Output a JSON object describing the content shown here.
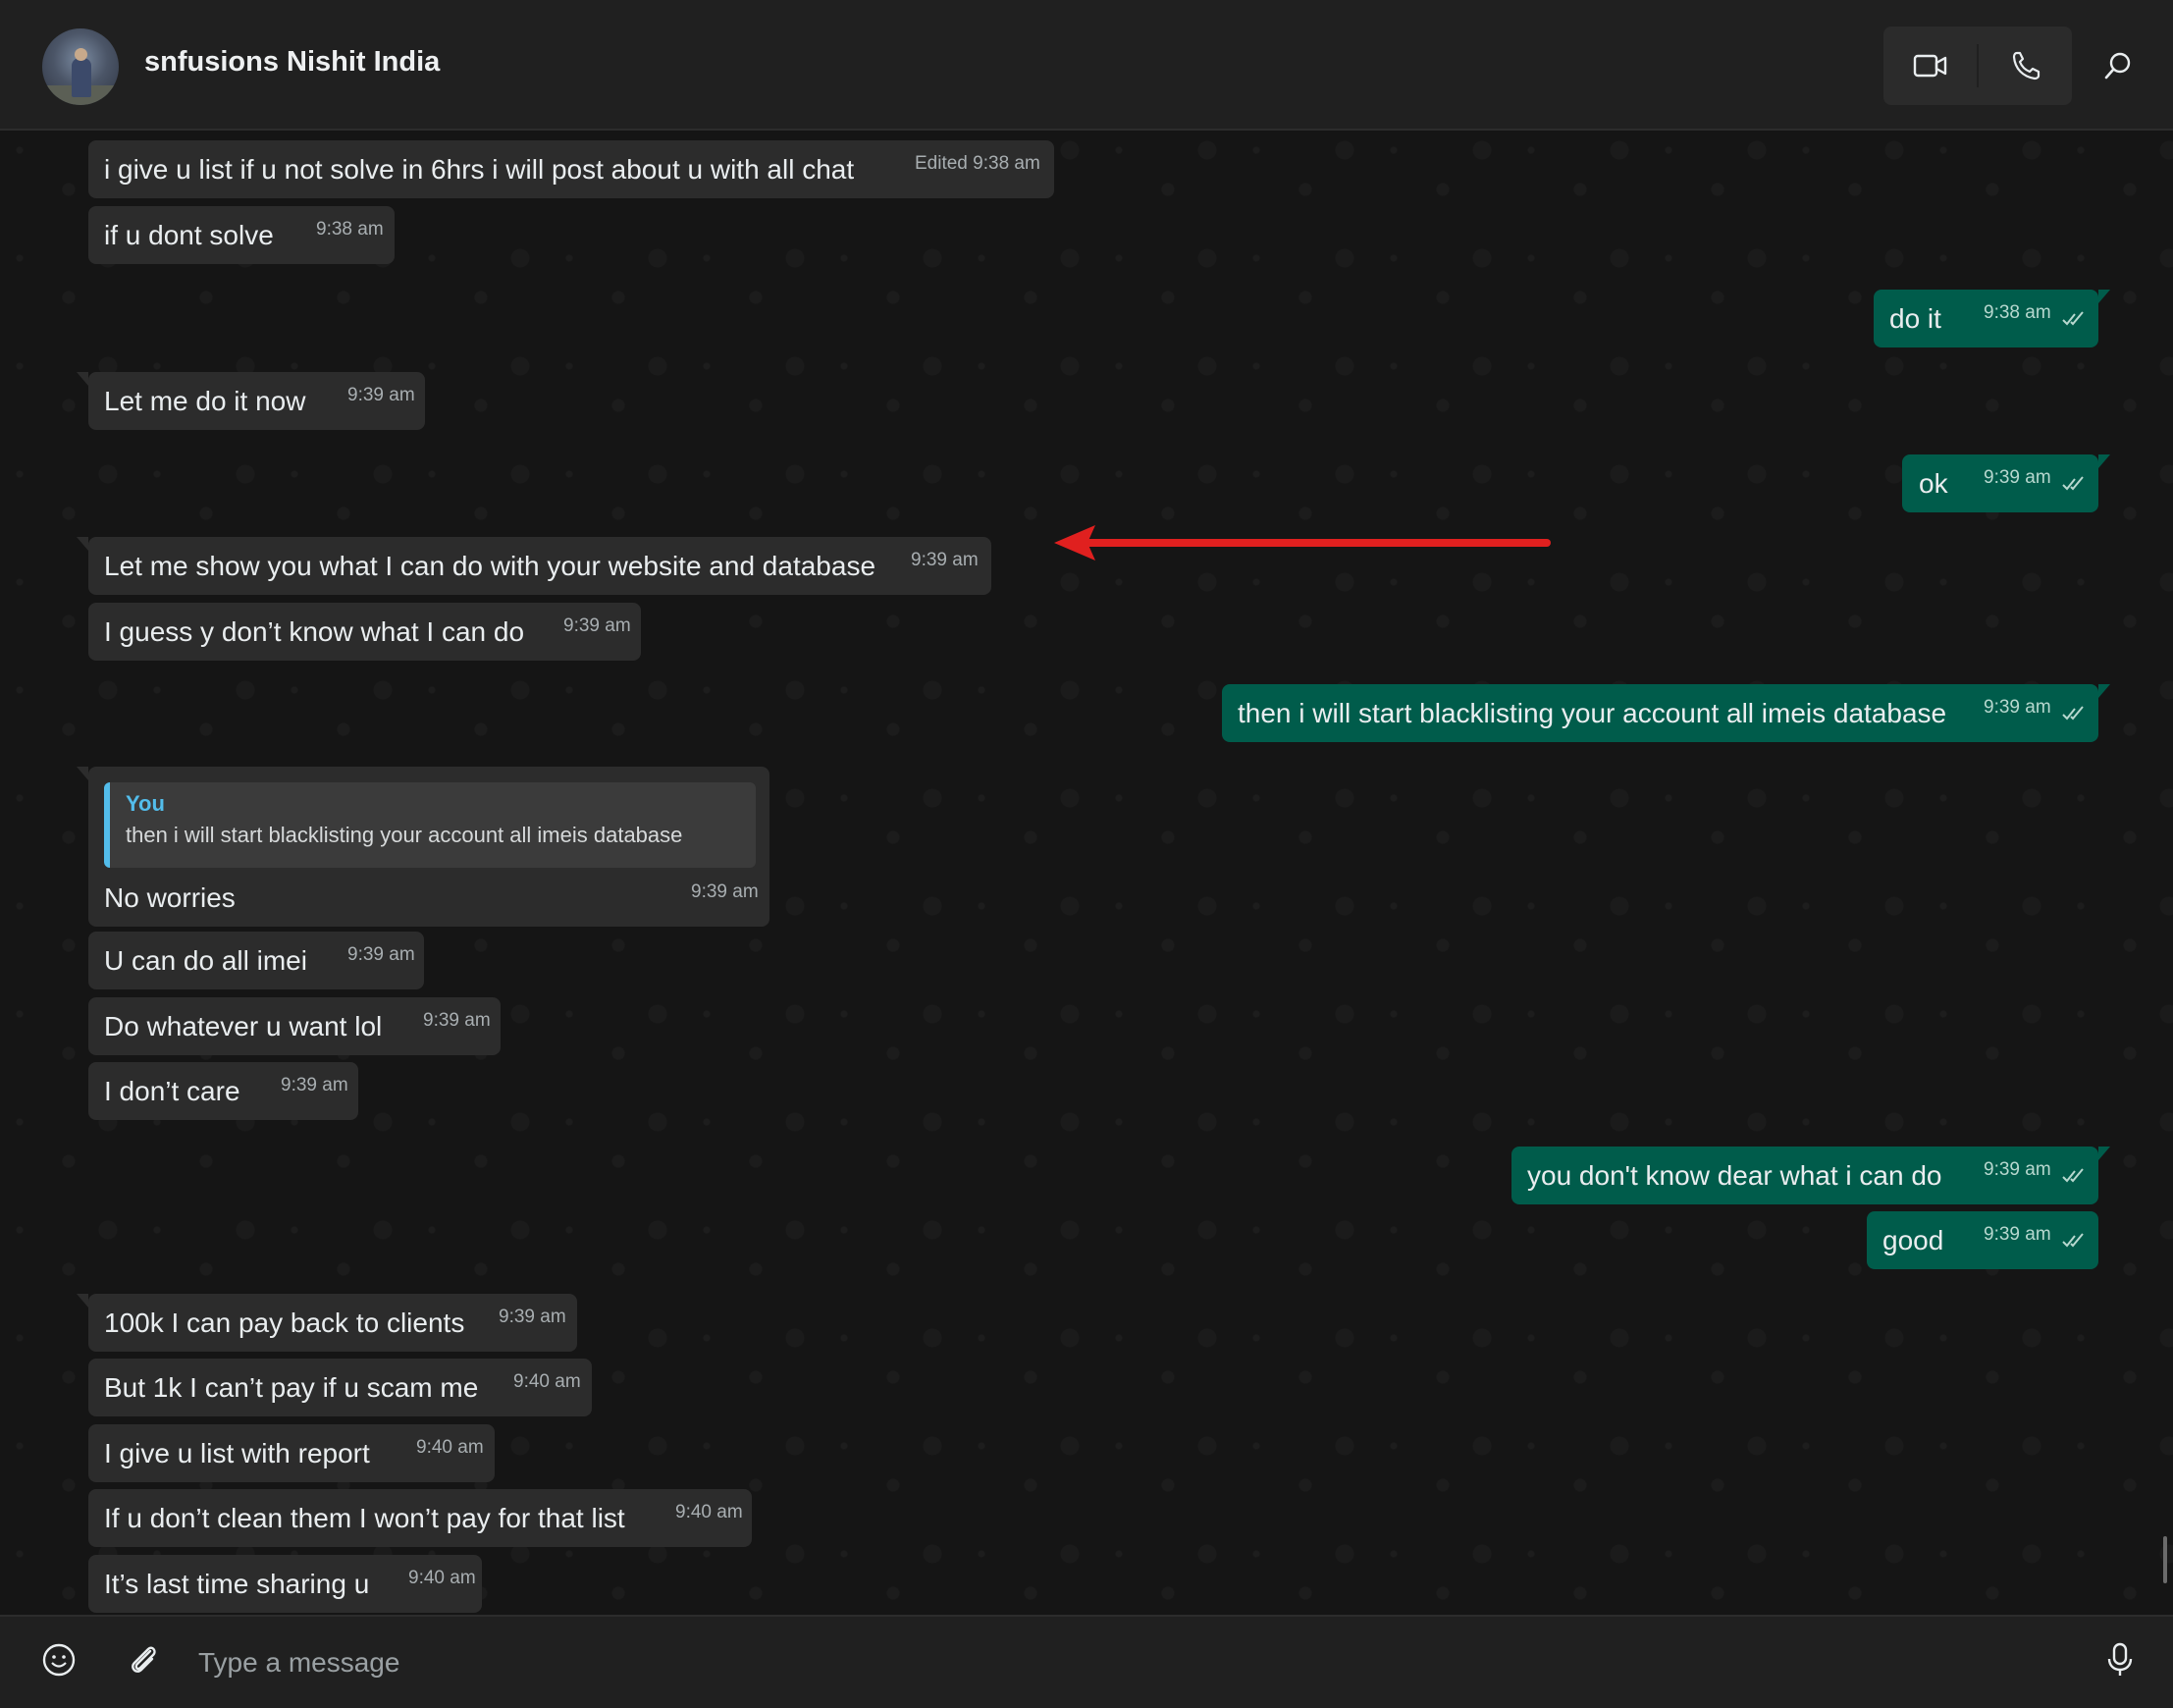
{
  "header": {
    "contact_name": "snfusions Nishit India"
  },
  "messages": [
    {
      "dir": "in",
      "text": "i give u list if u not solve in 6hrs i will post about u with all chat",
      "time": "Edited 9:38 am"
    },
    {
      "dir": "in",
      "text": "if u dont solve",
      "time": "9:38 am"
    },
    {
      "dir": "out",
      "text": "do it",
      "time": "9:38 am"
    },
    {
      "dir": "in",
      "text": "Let me do it now",
      "time": "9:39 am"
    },
    {
      "dir": "out",
      "text": "ok",
      "time": "9:39 am"
    },
    {
      "dir": "in",
      "text": "Let me show you what I can do with your website and database",
      "time": "9:39 am"
    },
    {
      "dir": "in",
      "text": "I guess y don’t know what I can do",
      "time": "9:39 am"
    },
    {
      "dir": "out",
      "text": "then i will start blacklisting your account all imeis database",
      "time": "9:39 am"
    },
    {
      "dir": "in",
      "text": "No worries",
      "time": "9:39 am",
      "quote_author": "You",
      "quote_text": "then i will start blacklisting your account all imeis database"
    },
    {
      "dir": "in",
      "text": "U can do all imei",
      "time": "9:39 am"
    },
    {
      "dir": "in",
      "text": "Do whatever u want lol",
      "time": "9:39 am"
    },
    {
      "dir": "in",
      "text": "I don’t care",
      "time": "9:39 am"
    },
    {
      "dir": "out",
      "text": "you don't know dear what i can do",
      "time": "9:39 am"
    },
    {
      "dir": "out",
      "text": "good",
      "time": "9:39 am"
    },
    {
      "dir": "in",
      "text": "100k I can pay back to clients",
      "time": "9:39 am"
    },
    {
      "dir": "in",
      "text": "But 1k I can’t pay if u scam me",
      "time": "9:40 am"
    },
    {
      "dir": "in",
      "text": "I give u list with report",
      "time": "9:40 am"
    },
    {
      "dir": "in",
      "text": "If u don’t clean them I won’t pay for that list",
      "time": "9:40 am"
    },
    {
      "dir": "in",
      "text": "It’s last time sharing u",
      "time": "9:40 am"
    }
  ],
  "composer": {
    "placeholder": "Type a message"
  },
  "colors": {
    "incoming_bubble": "#2c2c2c",
    "outgoing_bubble": "#005c4b",
    "quote_accent": "#53bdeb",
    "annotation_arrow": "#e0201f"
  },
  "icons": [
    "video-call-icon",
    "voice-call-icon",
    "search-icon",
    "emoji-icon",
    "attach-icon",
    "microphone-icon",
    "scroll-down-icon",
    "double-check-icon"
  ]
}
